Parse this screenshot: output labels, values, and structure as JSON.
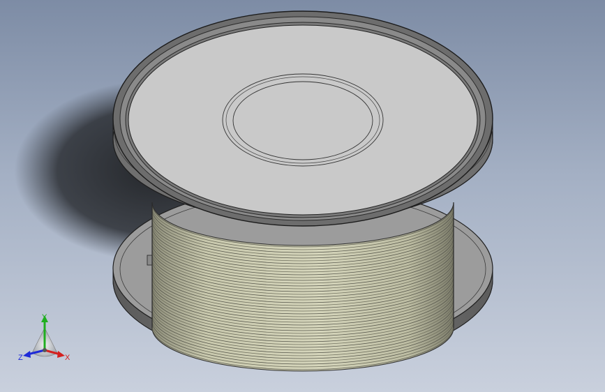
{
  "viewport": {
    "background_top": "#7d8ca5",
    "background_bottom": "#c9d0dd"
  },
  "model": {
    "type": "wire-spool",
    "flange_color": "#c8c8c8",
    "rim_color": "#6c6c6c",
    "wire_color": "#cfcfb2",
    "edge_color": "#2a2a2a"
  },
  "triad": {
    "x_label": "X",
    "y_label": "Y",
    "z_label": "Z",
    "x_color": "#d42020",
    "y_color": "#1fae1f",
    "z_color": "#1e2ad8"
  }
}
